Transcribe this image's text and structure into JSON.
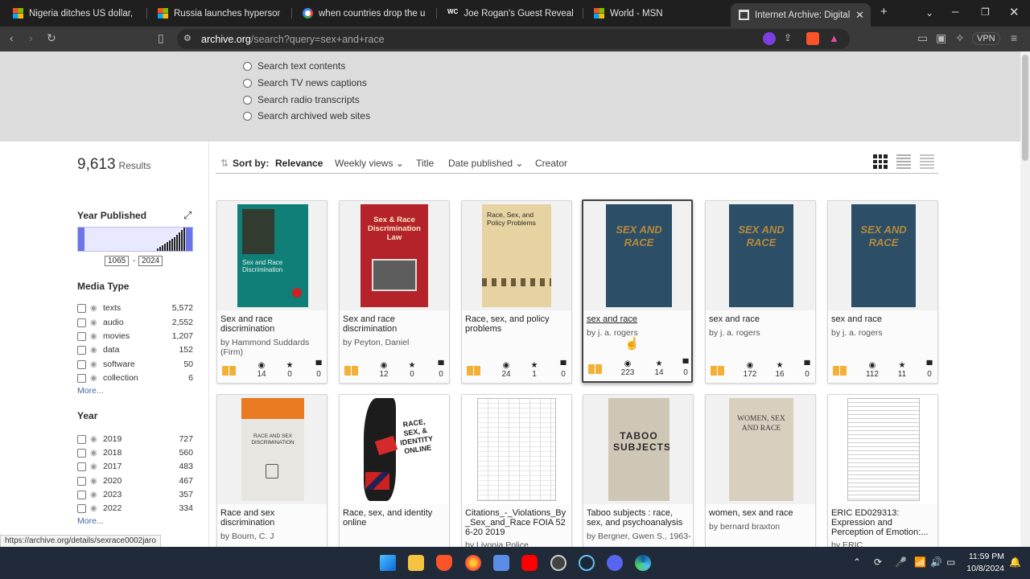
{
  "browser": {
    "tabs": [
      {
        "title": "Nigeria ditches US dollar, will now",
        "icon": "microsoft-icon"
      },
      {
        "title": "Russia launches hypersonic missi",
        "icon": "microsoft-icon"
      },
      {
        "title": "when countries drop the us dolla",
        "icon": "google-icon"
      },
      {
        "title": "Joe Rogan's Guest Reveals Disturb",
        "icon": "wc-icon"
      },
      {
        "title": "World - MSN",
        "icon": "microsoft-icon"
      },
      {
        "title": "Internet Archive: Digital Libr",
        "icon": "archive-icon"
      }
    ],
    "url_host": "archive.org",
    "url_path": "/search?query=sex+and+race",
    "vpn_label": "VPN"
  },
  "search_options": [
    "Search text contents",
    "Search TV news captions",
    "Search radio transcripts",
    "Search archived web sites"
  ],
  "results": {
    "count": "9,613",
    "label": "Results"
  },
  "year_published": {
    "title": "Year Published",
    "from": "1065",
    "to": "2024"
  },
  "media_type": {
    "title": "Media Type",
    "items": [
      {
        "label": "texts",
        "count": "5,572"
      },
      {
        "label": "audio",
        "count": "2,552"
      },
      {
        "label": "movies",
        "count": "1,207"
      },
      {
        "label": "data",
        "count": "152"
      },
      {
        "label": "software",
        "count": "50"
      },
      {
        "label": "collection",
        "count": "6"
      }
    ],
    "more": "More..."
  },
  "year": {
    "title": "Year",
    "items": [
      {
        "label": "2019",
        "count": "727"
      },
      {
        "label": "2018",
        "count": "560"
      },
      {
        "label": "2017",
        "count": "483"
      },
      {
        "label": "2020",
        "count": "467"
      },
      {
        "label": "2023",
        "count": "357"
      },
      {
        "label": "2022",
        "count": "334"
      }
    ],
    "more": "More..."
  },
  "sort": {
    "label": "Sort by:",
    "options": [
      "Relevance",
      "Weekly views",
      "Title",
      "Date published",
      "Creator"
    ]
  },
  "items": [
    {
      "title": "Sex and race discrimination",
      "by": "by Hammond Suddards (Firm)",
      "views": "14",
      "favs": "0",
      "reviews": "0",
      "cover_title": "Sex and Race Discrimination"
    },
    {
      "title": "Sex and race discrimination",
      "by": "by Peyton, Daniel",
      "views": "12",
      "favs": "0",
      "reviews": "0",
      "cover_title": "Sex & Race Discrimination Law"
    },
    {
      "title": "Race, sex, and policy problems",
      "by": "",
      "views": "24",
      "favs": "1",
      "reviews": "0",
      "cover_title": "Race, Sex, and Policy Problems"
    },
    {
      "title": "sex and race",
      "by": "by j. a. rogers",
      "views": "223",
      "favs": "14",
      "reviews": "0",
      "cover_title": "SEX AND RACE"
    },
    {
      "title": "sex and race",
      "by": "by j. a. rogers",
      "views": "172",
      "favs": "16",
      "reviews": "0",
      "cover_title": "SEX AND RACE"
    },
    {
      "title": "sex and race",
      "by": "by j. a. rogers",
      "views": "112",
      "favs": "11",
      "reviews": "0",
      "cover_title": "SEX AND RACE"
    },
    {
      "title": "Race and sex discrimination",
      "by": "by Bourn, C. J",
      "cover_title": "RACE AND SEX DISCRIMINATION"
    },
    {
      "title": "Race, sex, and identity online",
      "by": "",
      "cover_title": "RACE, SEX, & IDENTITY ONLINE"
    },
    {
      "title": "Citations_-_Violations_By_Sex_and_Race FOIA 526-20 2019",
      "by": "by Livonia Police",
      "cover_title": ""
    },
    {
      "title": "Taboo subjects : race, sex, and psychoanalysis",
      "by": "by Bergner, Gwen S., 1963-",
      "cover_title": "TABOO SUBJECTS"
    },
    {
      "title": "women, sex and race",
      "by": "by bernard braxton",
      "cover_title": "WOMEN, SEX AND RACE"
    },
    {
      "title": "ERIC ED029313: Expression and Perception of Emotion:...",
      "by": "by ERIC",
      "cover_title": ""
    }
  ],
  "status_url": "https://archive.org/details/sexrace0002jaro",
  "clock": {
    "time": "11:59 PM",
    "date": "10/8/2024"
  }
}
